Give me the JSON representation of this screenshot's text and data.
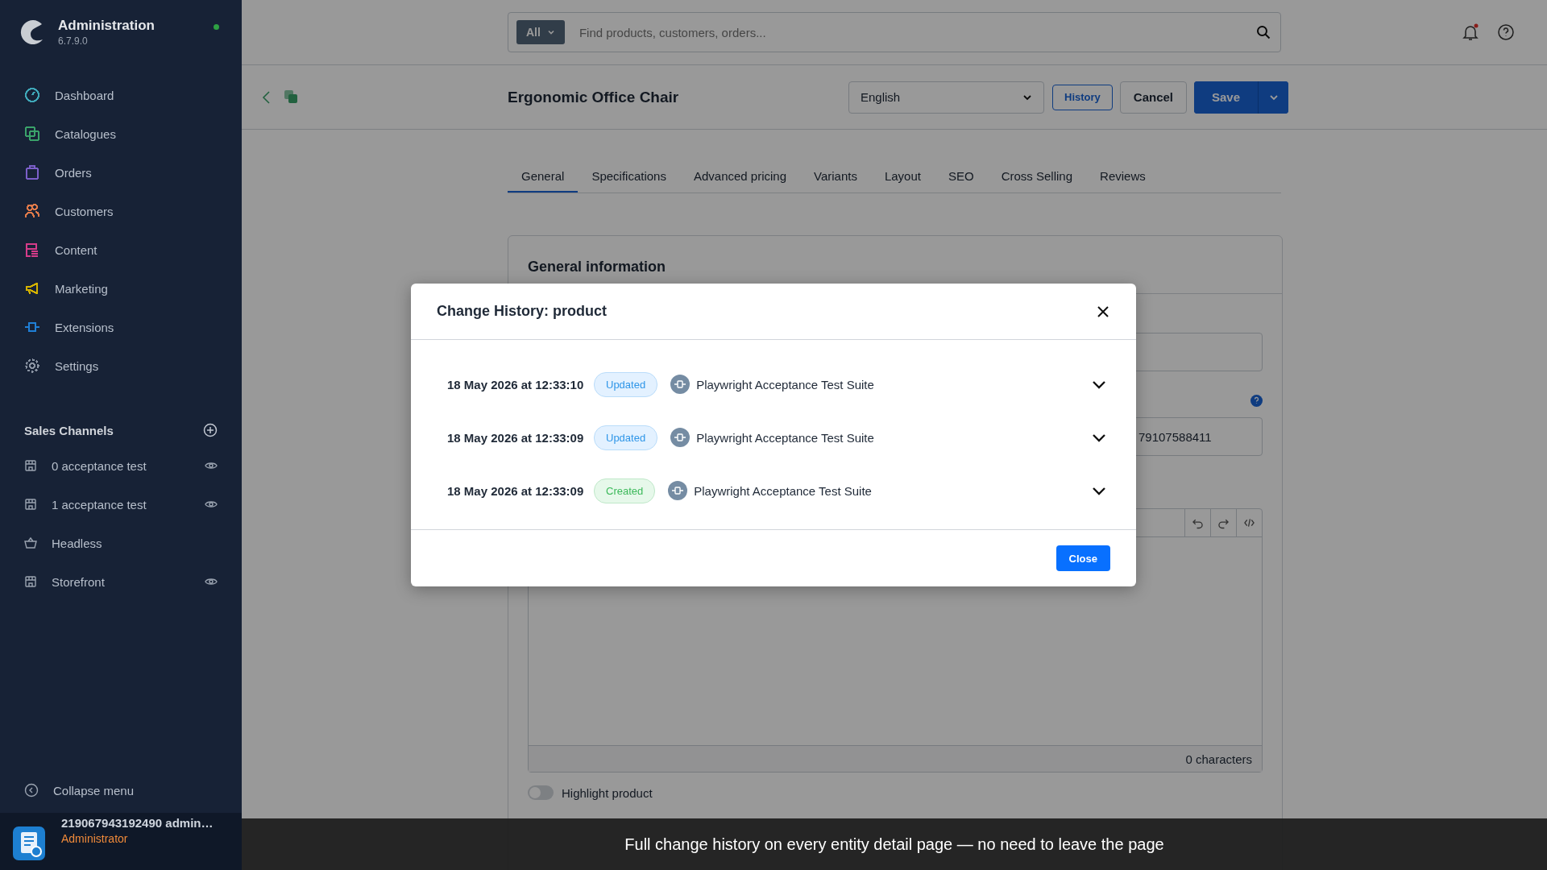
{
  "sidebar": {
    "title": "Administration",
    "version": "6.7.9.0",
    "nav": [
      {
        "label": "Dashboard",
        "kind": "gauge",
        "color": "#3fa7b8"
      },
      {
        "label": "Catalogues",
        "kind": "copies",
        "color": "#3aa26a"
      },
      {
        "label": "Orders",
        "kind": "bag",
        "color": "#7b5fc9"
      },
      {
        "label": "Customers",
        "kind": "people",
        "color": "#e07a4a"
      },
      {
        "label": "Content",
        "kind": "list",
        "color": "#d63c8a"
      },
      {
        "label": "Marketing",
        "kind": "megaphone",
        "color": "#d4b200"
      },
      {
        "label": "Extensions",
        "kind": "plug",
        "color": "#1f7fd6"
      },
      {
        "label": "Settings",
        "kind": "gear",
        "color": "#8a94a3"
      }
    ],
    "sales_channels": {
      "heading": "Sales Channels",
      "items": [
        {
          "label": "0 acceptance test",
          "kind": "store",
          "preview": true
        },
        {
          "label": "1 acceptance test",
          "kind": "store",
          "preview": true
        },
        {
          "label": "Headless",
          "kind": "basket",
          "preview": false
        },
        {
          "label": "Storefront",
          "kind": "store",
          "preview": true
        }
      ]
    },
    "collapse": "Collapse menu",
    "user": {
      "name": "219067943192490 admin…",
      "role": "Administrator"
    }
  },
  "search": {
    "scope": "All",
    "placeholder": "Find products, customers, orders..."
  },
  "header": {
    "title": "Ergonomic Office Chair",
    "language": "English",
    "history": "History",
    "cancel": "Cancel",
    "save": "Save"
  },
  "tabs": [
    {
      "label": "General",
      "selected": true
    },
    {
      "label": "Specifications",
      "selected": false
    },
    {
      "label": "Advanced pricing",
      "selected": false
    },
    {
      "label": "Variants",
      "selected": false
    },
    {
      "label": "Layout",
      "selected": false
    },
    {
      "label": "SEO",
      "selected": false
    },
    {
      "label": "Cross Selling",
      "selected": false
    },
    {
      "label": "Reviews",
      "selected": false
    }
  ],
  "card": {
    "title": "General information",
    "number_value": "79107588411",
    "editor_footer": "0 characters",
    "highlight": {
      "label": "Highlight product",
      "on": false
    }
  },
  "modal": {
    "title": "Change History: product",
    "entries": [
      {
        "time": "18 May 2026 at 12:33:10",
        "action": "Updated",
        "kind": "updated",
        "user": "Playwright Acceptance Test Suite",
        "expanded": false
      },
      {
        "time": "18 May 2026 at 12:33:09",
        "action": "Updated",
        "kind": "updated",
        "user": "Playwright Acceptance Test Suite",
        "expanded": false
      },
      {
        "time": "18 May 2026 at 12:33:09",
        "action": "Created",
        "kind": "created",
        "user": "Playwright Acceptance Test Suite",
        "expanded": false
      }
    ],
    "close": "Close"
  },
  "caption": "Full change history on every entity detail page — no need to leave the page"
}
